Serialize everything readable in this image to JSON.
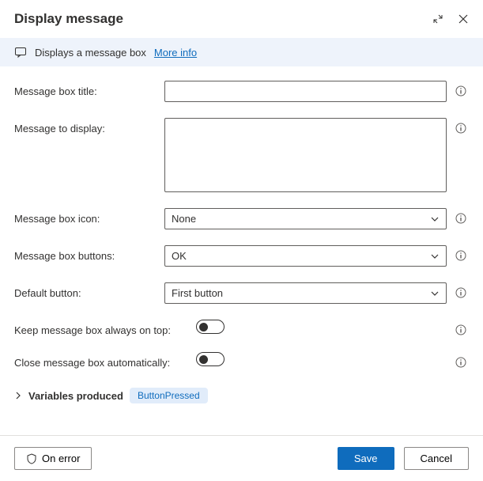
{
  "header": {
    "title": "Display message"
  },
  "infoBar": {
    "text": "Displays a message box",
    "linkText": "More info"
  },
  "fields": {
    "title": {
      "label": "Message box title:",
      "value": ""
    },
    "message": {
      "label": "Message to display:",
      "value": ""
    },
    "icon": {
      "label": "Message box icon:",
      "value": "None"
    },
    "buttons": {
      "label": "Message box buttons:",
      "value": "OK"
    },
    "defaultButton": {
      "label": "Default button:",
      "value": "First button"
    },
    "alwaysOnTop": {
      "label": "Keep message box always on top:",
      "value": false
    },
    "autoClose": {
      "label": "Close message box automatically:",
      "value": false
    }
  },
  "variables": {
    "label": "Variables produced",
    "items": [
      "ButtonPressed"
    ]
  },
  "footer": {
    "onError": "On error",
    "save": "Save",
    "cancel": "Cancel"
  }
}
